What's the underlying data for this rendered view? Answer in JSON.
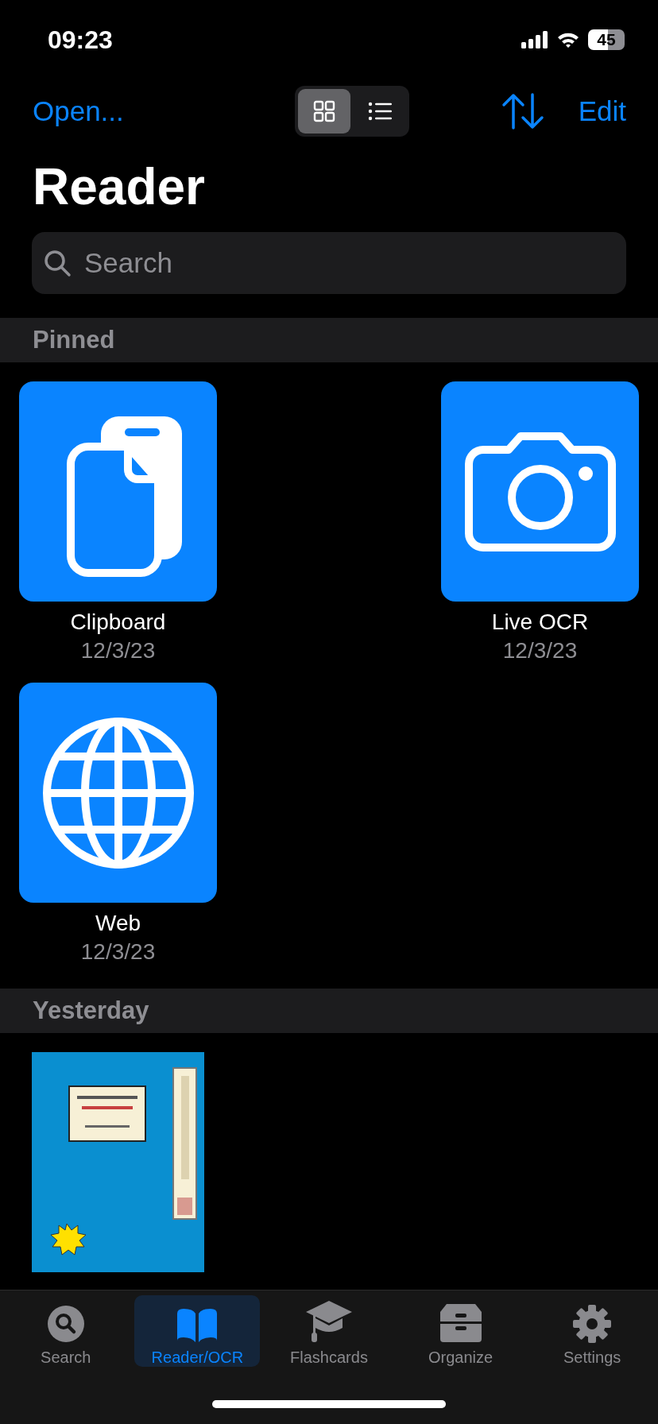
{
  "status_bar": {
    "time": "09:23",
    "battery": "45"
  },
  "nav": {
    "open": "Open...",
    "edit": "Edit",
    "view_modes": [
      {
        "kind": "grid",
        "selected": true
      },
      {
        "kind": "list",
        "selected": false
      }
    ]
  },
  "title": "Reader",
  "search": {
    "placeholder": "Search"
  },
  "sections": [
    {
      "title": "Pinned",
      "items": [
        {
          "kind": "clipboard",
          "name": "Clipboard",
          "date": "12/3/23"
        },
        {
          "kind": "camera",
          "name": "Live OCR",
          "date": "12/3/23"
        },
        {
          "kind": "globe",
          "name": "Web",
          "date": "12/3/23"
        }
      ]
    },
    {
      "title": "Yesterday"
    }
  ],
  "tabs": [
    {
      "kind": "search",
      "label": "Search",
      "selected": false
    },
    {
      "kind": "book",
      "label": "Reader/OCR",
      "selected": true
    },
    {
      "kind": "cap",
      "label": "Flashcards",
      "selected": false
    },
    {
      "kind": "tray",
      "label": "Organize",
      "selected": false
    },
    {
      "kind": "gear",
      "label": "Settings",
      "selected": false
    }
  ]
}
